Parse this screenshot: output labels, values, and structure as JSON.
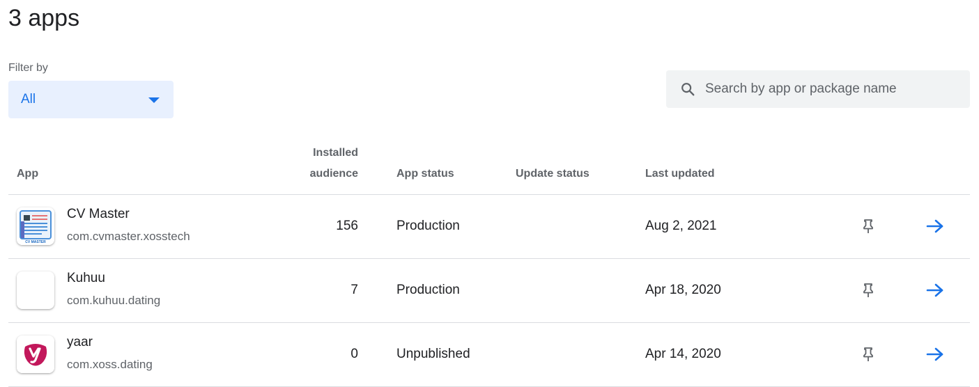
{
  "header": {
    "title": "3 apps"
  },
  "filter": {
    "label": "Filter by",
    "selected": "All"
  },
  "search": {
    "placeholder": "Search by app or package name",
    "value": ""
  },
  "table": {
    "columns": {
      "app": "App",
      "installed_line1": "Installed",
      "installed_line2": "audience",
      "app_status": "App status",
      "update_status": "Update status",
      "last_updated": "Last updated"
    },
    "rows": [
      {
        "name": "CV Master",
        "package": "com.cvmaster.xosstech",
        "installed": "156",
        "app_status": "Production",
        "update_status": "",
        "last_updated": "Aug 2, 2021",
        "icon": "cv-master-icon",
        "icon_text": "CV MASTER"
      },
      {
        "name": "Kuhuu",
        "package": "com.kuhuu.dating",
        "installed": "7",
        "app_status": "Production",
        "update_status": "",
        "last_updated": "Apr 18, 2020",
        "icon": "blank-app-icon"
      },
      {
        "name": "yaar",
        "package": "com.xoss.dating",
        "installed": "0",
        "app_status": "Unpublished",
        "update_status": "",
        "last_updated": "Apr 14, 2020",
        "icon": "yaar-logo-icon"
      }
    ]
  },
  "icons": {
    "search": "search-icon",
    "dropdown": "caret-down-icon",
    "pin": "pin-icon",
    "open": "arrow-right-icon"
  },
  "colors": {
    "accent": "#1a73e8",
    "filter_bg": "#e8f0fe",
    "search_bg": "#f1f3f4",
    "divider": "#dadce0",
    "secondary_text": "#5f6368",
    "yaar_brand": "#c2185b"
  }
}
